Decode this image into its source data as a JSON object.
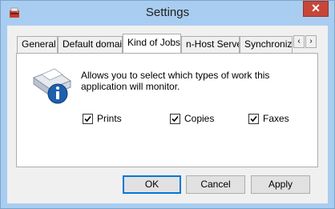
{
  "window": {
    "title": "Settings",
    "close_label": "✕"
  },
  "tabs": [
    {
      "label": "General",
      "active": false
    },
    {
      "label": "Default domain",
      "active": false
    },
    {
      "label": "Kind of Jobs",
      "active": true
    },
    {
      "label": "n-Host Server",
      "active": false
    },
    {
      "label": "Synchronize",
      "active": false
    }
  ],
  "tab_scroll": {
    "left": "‹",
    "right": "›"
  },
  "panel": {
    "description": "Allows you to select which types of work this application will monitor.",
    "icon": "printer-info-icon",
    "checkboxes": [
      {
        "label": "Prints",
        "checked": true
      },
      {
        "label": "Copies",
        "checked": true
      },
      {
        "label": "Faxes",
        "checked": true
      }
    ]
  },
  "buttons": {
    "ok": "OK",
    "cancel": "Cancel",
    "apply": "Apply"
  },
  "colors": {
    "titlebar": "#a9cdf0",
    "close": "#c7463a",
    "info_blue": "#1f5fae"
  }
}
